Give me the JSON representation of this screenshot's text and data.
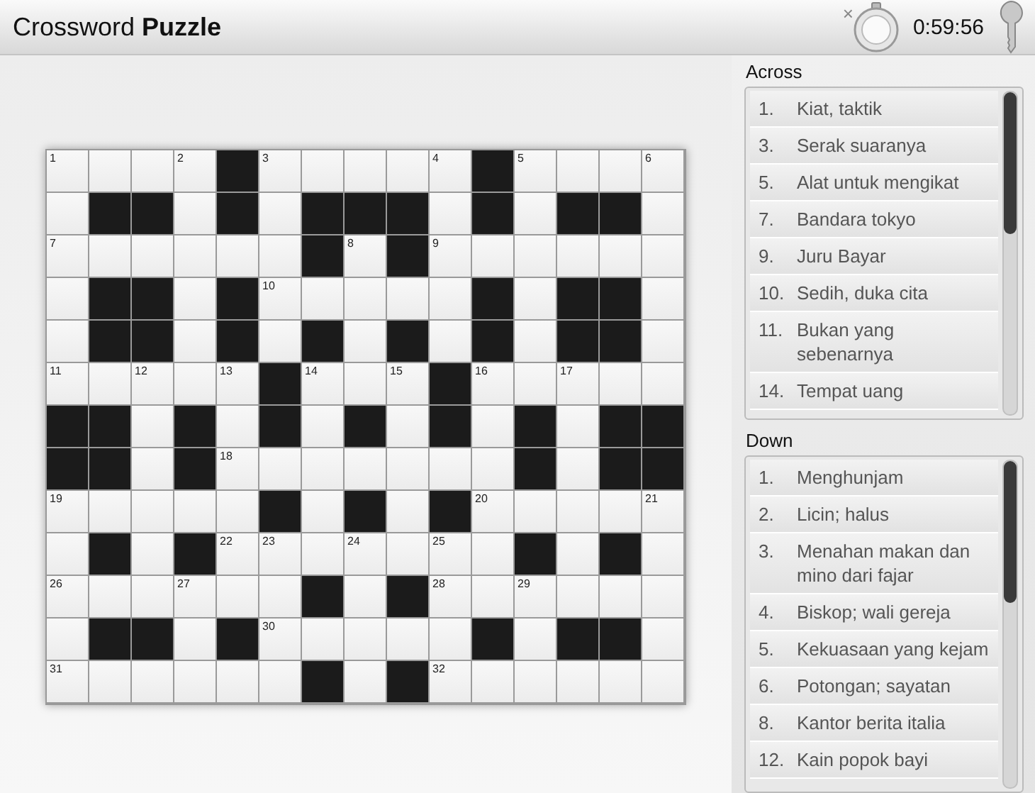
{
  "header": {
    "title_plain": "Crossword",
    "title_bold": "Puzzle",
    "close_glyph": "×",
    "timer": "0:59:56"
  },
  "grid": {
    "rows": [
      {
        "cells": [
          {
            "kind": "open",
            "number": "1"
          },
          {
            "kind": "open"
          },
          {
            "kind": "open"
          },
          {
            "kind": "open",
            "number": "2"
          },
          {
            "kind": "block"
          },
          {
            "kind": "open",
            "number": "3"
          },
          {
            "kind": "open"
          },
          {
            "kind": "open"
          },
          {
            "kind": "open"
          },
          {
            "kind": "open",
            "number": "4"
          },
          {
            "kind": "block"
          },
          {
            "kind": "open",
            "number": "5"
          },
          {
            "kind": "open"
          },
          {
            "kind": "open"
          },
          {
            "kind": "open",
            "number": "6"
          }
        ]
      },
      {
        "cells": [
          {
            "kind": "open"
          },
          {
            "kind": "block"
          },
          {
            "kind": "block"
          },
          {
            "kind": "open"
          },
          {
            "kind": "block"
          },
          {
            "kind": "open"
          },
          {
            "kind": "block"
          },
          {
            "kind": "block"
          },
          {
            "kind": "block"
          },
          {
            "kind": "open"
          },
          {
            "kind": "block"
          },
          {
            "kind": "open"
          },
          {
            "kind": "block"
          },
          {
            "kind": "block"
          },
          {
            "kind": "open"
          }
        ]
      },
      {
        "cells": [
          {
            "kind": "open",
            "number": "7"
          },
          {
            "kind": "open"
          },
          {
            "kind": "open"
          },
          {
            "kind": "open"
          },
          {
            "kind": "open"
          },
          {
            "kind": "open"
          },
          {
            "kind": "block"
          },
          {
            "kind": "open",
            "number": "8"
          },
          {
            "kind": "block"
          },
          {
            "kind": "open",
            "number": "9"
          },
          {
            "kind": "open"
          },
          {
            "kind": "open"
          },
          {
            "kind": "open"
          },
          {
            "kind": "open"
          },
          {
            "kind": "open"
          }
        ]
      },
      {
        "cells": [
          {
            "kind": "open"
          },
          {
            "kind": "block"
          },
          {
            "kind": "block"
          },
          {
            "kind": "open"
          },
          {
            "kind": "block"
          },
          {
            "kind": "open",
            "number": "10"
          },
          {
            "kind": "open"
          },
          {
            "kind": "open"
          },
          {
            "kind": "open"
          },
          {
            "kind": "open"
          },
          {
            "kind": "block"
          },
          {
            "kind": "open"
          },
          {
            "kind": "block"
          },
          {
            "kind": "block"
          },
          {
            "kind": "open"
          }
        ]
      },
      {
        "cells": [
          {
            "kind": "open"
          },
          {
            "kind": "block"
          },
          {
            "kind": "block"
          },
          {
            "kind": "open"
          },
          {
            "kind": "block"
          },
          {
            "kind": "open"
          },
          {
            "kind": "block"
          },
          {
            "kind": "open"
          },
          {
            "kind": "block"
          },
          {
            "kind": "open"
          },
          {
            "kind": "block"
          },
          {
            "kind": "open"
          },
          {
            "kind": "block"
          },
          {
            "kind": "block"
          },
          {
            "kind": "open"
          }
        ]
      },
      {
        "cells": [
          {
            "kind": "open",
            "number": "11"
          },
          {
            "kind": "open"
          },
          {
            "kind": "open",
            "number": "12"
          },
          {
            "kind": "open"
          },
          {
            "kind": "open",
            "number": "13"
          },
          {
            "kind": "block"
          },
          {
            "kind": "open",
            "number": "14"
          },
          {
            "kind": "open"
          },
          {
            "kind": "open",
            "number": "15"
          },
          {
            "kind": "block"
          },
          {
            "kind": "open",
            "number": "16"
          },
          {
            "kind": "open"
          },
          {
            "kind": "open",
            "number": "17"
          },
          {
            "kind": "open"
          },
          {
            "kind": "open"
          }
        ]
      },
      {
        "cells": [
          {
            "kind": "block"
          },
          {
            "kind": "block"
          },
          {
            "kind": "open"
          },
          {
            "kind": "block"
          },
          {
            "kind": "open"
          },
          {
            "kind": "block"
          },
          {
            "kind": "open"
          },
          {
            "kind": "block"
          },
          {
            "kind": "open"
          },
          {
            "kind": "block"
          },
          {
            "kind": "open"
          },
          {
            "kind": "block"
          },
          {
            "kind": "open"
          },
          {
            "kind": "block"
          },
          {
            "kind": "block"
          }
        ]
      },
      {
        "cells": [
          {
            "kind": "block"
          },
          {
            "kind": "block"
          },
          {
            "kind": "open"
          },
          {
            "kind": "block"
          },
          {
            "kind": "open",
            "number": "18"
          },
          {
            "kind": "open"
          },
          {
            "kind": "open"
          },
          {
            "kind": "open"
          },
          {
            "kind": "open"
          },
          {
            "kind": "open"
          },
          {
            "kind": "open"
          },
          {
            "kind": "block"
          },
          {
            "kind": "open"
          },
          {
            "kind": "block"
          },
          {
            "kind": "block"
          }
        ]
      },
      {
        "cells": [
          {
            "kind": "open",
            "number": "19"
          },
          {
            "kind": "open"
          },
          {
            "kind": "open"
          },
          {
            "kind": "open"
          },
          {
            "kind": "open"
          },
          {
            "kind": "block"
          },
          {
            "kind": "open"
          },
          {
            "kind": "block"
          },
          {
            "kind": "open"
          },
          {
            "kind": "block"
          },
          {
            "kind": "open",
            "number": "20"
          },
          {
            "kind": "open"
          },
          {
            "kind": "open"
          },
          {
            "kind": "open"
          },
          {
            "kind": "open",
            "number": "21"
          }
        ]
      },
      {
        "cells": [
          {
            "kind": "open"
          },
          {
            "kind": "block"
          },
          {
            "kind": "open"
          },
          {
            "kind": "block"
          },
          {
            "kind": "open",
            "number": "22"
          },
          {
            "kind": "open",
            "number": "23"
          },
          {
            "kind": "open"
          },
          {
            "kind": "open",
            "number": "24"
          },
          {
            "kind": "open"
          },
          {
            "kind": "open",
            "number": "25"
          },
          {
            "kind": "open"
          },
          {
            "kind": "block"
          },
          {
            "kind": "open"
          },
          {
            "kind": "block"
          },
          {
            "kind": "open"
          }
        ]
      },
      {
        "cells": [
          {
            "kind": "open",
            "number": "26"
          },
          {
            "kind": "open"
          },
          {
            "kind": "open"
          },
          {
            "kind": "open",
            "number": "27"
          },
          {
            "kind": "open"
          },
          {
            "kind": "open"
          },
          {
            "kind": "block"
          },
          {
            "kind": "open"
          },
          {
            "kind": "block"
          },
          {
            "kind": "open",
            "number": "28"
          },
          {
            "kind": "open"
          },
          {
            "kind": "open",
            "number": "29"
          },
          {
            "kind": "open"
          },
          {
            "kind": "open"
          },
          {
            "kind": "open"
          }
        ]
      },
      {
        "cells": [
          {
            "kind": "open"
          },
          {
            "kind": "block"
          },
          {
            "kind": "block"
          },
          {
            "kind": "open"
          },
          {
            "kind": "block"
          },
          {
            "kind": "open",
            "number": "30"
          },
          {
            "kind": "open"
          },
          {
            "kind": "open"
          },
          {
            "kind": "open"
          },
          {
            "kind": "open"
          },
          {
            "kind": "block"
          },
          {
            "kind": "open"
          },
          {
            "kind": "block"
          },
          {
            "kind": "block"
          },
          {
            "kind": "open"
          }
        ]
      },
      {
        "cells": [
          {
            "kind": "open",
            "number": "31"
          },
          {
            "kind": "open"
          },
          {
            "kind": "open"
          },
          {
            "kind": "open"
          },
          {
            "kind": "open"
          },
          {
            "kind": "open"
          },
          {
            "kind": "block"
          },
          {
            "kind": "open"
          },
          {
            "kind": "block"
          },
          {
            "kind": "open",
            "number": "32"
          },
          {
            "kind": "open"
          },
          {
            "kind": "open"
          },
          {
            "kind": "open"
          },
          {
            "kind": "open"
          },
          {
            "kind": "open"
          }
        ]
      }
    ]
  },
  "clue_lists": [
    {
      "title": "Across",
      "clues": [
        {
          "number": "1.",
          "text": "Kiat, taktik"
        },
        {
          "number": "3.",
          "text": "Serak suaranya"
        },
        {
          "number": "5.",
          "text": "Alat untuk mengikat"
        },
        {
          "number": "7.",
          "text": "Bandara tokyo"
        },
        {
          "number": "9.",
          "text": "Juru Bayar"
        },
        {
          "number": "10.",
          "text": "Sedih, duka cita"
        },
        {
          "number": "11.",
          "text": "Bukan yang sebenarnya"
        },
        {
          "number": "14.",
          "text": "Tempat uang"
        }
      ]
    },
    {
      "title": "Down",
      "clues": [
        {
          "number": "1.",
          "text": "Menghunjam"
        },
        {
          "number": "2.",
          "text": "Licin; halus"
        },
        {
          "number": "3.",
          "text": "Menahan makan dan mino dari fajar"
        },
        {
          "number": "4.",
          "text": "Biskop; wali gereja"
        },
        {
          "number": "5.",
          "text": "Kekuasaan yang kejam"
        },
        {
          "number": "6.",
          "text": "Potongan; sayatan"
        },
        {
          "number": "8.",
          "text": "Kantor berita italia"
        },
        {
          "number": "12.",
          "text": "Kain popok bayi"
        }
      ]
    }
  ]
}
